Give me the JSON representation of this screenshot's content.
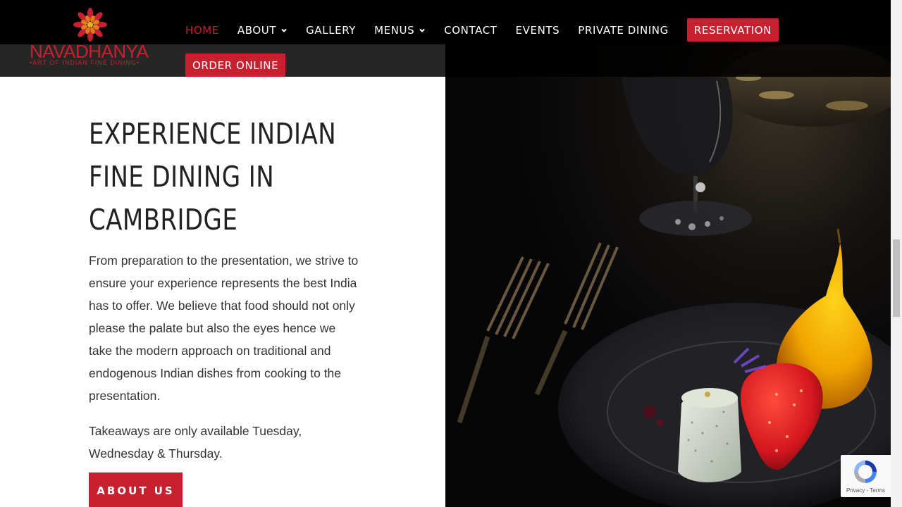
{
  "brand": {
    "name": "NAVADHANYA",
    "tagline": "•ART OF INDIAN FINE DINING•"
  },
  "nav": {
    "items": [
      {
        "label": "HOME",
        "active": true
      },
      {
        "label": "ABOUT",
        "dropdown": true
      },
      {
        "label": "GALLERY"
      },
      {
        "label": "MENUS",
        "dropdown": true
      },
      {
        "label": "CONTACT"
      },
      {
        "label": "EVENTS"
      },
      {
        "label": "PRIVATE DINING"
      }
    ],
    "reservation_label": "RESERVATION",
    "order_online_label": "ORDER ONLINE"
  },
  "hero": {
    "title_lines": [
      "EXPERIENCE INDIAN",
      "FINE DINING IN",
      "CAMBRIDGE"
    ],
    "paragraph1": "From preparation to the presentation, we strive to ensure your experience represents the best India has to offer. We believe that food should not only please the palate but also the eyes hence we take the modern approach on traditional and endogenous Indian dishes from cooking to the presentation.",
    "paragraph2": "Takeaways are only available Tuesday, Wednesday & Thursday.",
    "button_label": "ABOUT US"
  },
  "recaptcha": {
    "links": "Privacy - Terms"
  },
  "colors": {
    "accent": "#c8202f",
    "header_bg": "#000000",
    "text": "#333333"
  }
}
